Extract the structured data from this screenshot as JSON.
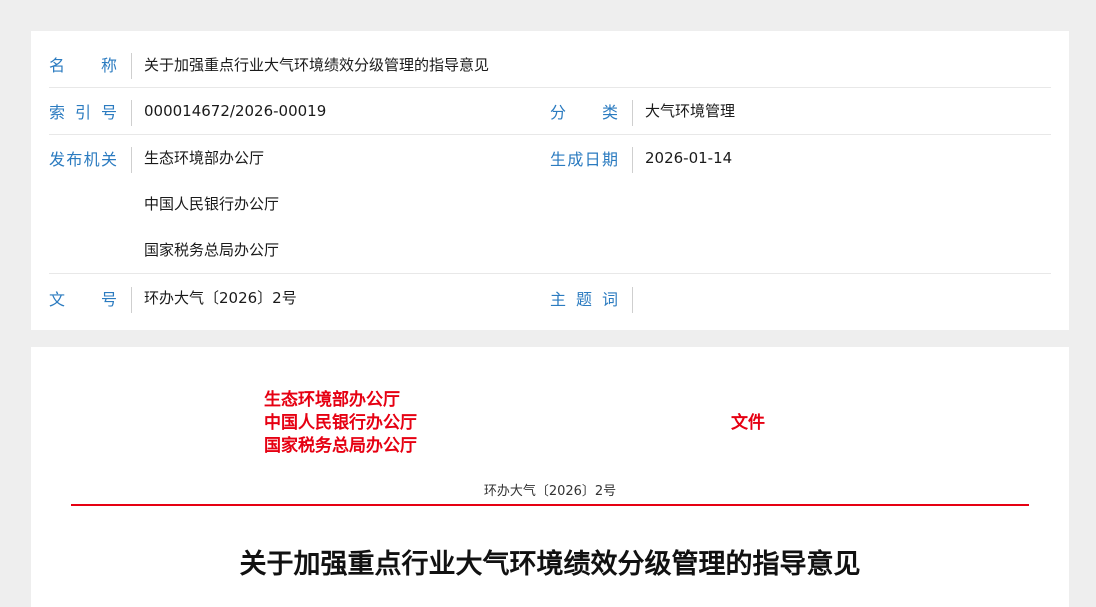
{
  "meta": {
    "name_label": "名　　称",
    "name_value": "关于加强重点行业大气环境绩效分级管理的指导意见",
    "index_label": "索 引 号",
    "index_value": "000014672/2026-00019",
    "category_label": "分　　类",
    "category_value": "大气环境管理",
    "issuer_label": "发布机关",
    "issuers": [
      "生态环境部办公厅",
      "中国人民银行办公厅",
      "国家税务总局办公厅"
    ],
    "date_label": "生成日期",
    "date_value": "2026-01-14",
    "docno_label": "文　　号",
    "docno_value": "环办大气〔2026〕2号",
    "keywords_label": "主 题 词",
    "keywords_value": ""
  },
  "document": {
    "issuers": [
      "生态环境部办公厅",
      "中国人民银行办公厅",
      "国家税务总局办公厅"
    ],
    "wenjian": "文件",
    "doc_number": "环办大气〔2026〕2号",
    "title": "关于加强重点行业大气环境绩效分级管理的指导意见"
  },
  "colors": {
    "label_blue": "#2b7bc0",
    "red": "#e60012"
  }
}
